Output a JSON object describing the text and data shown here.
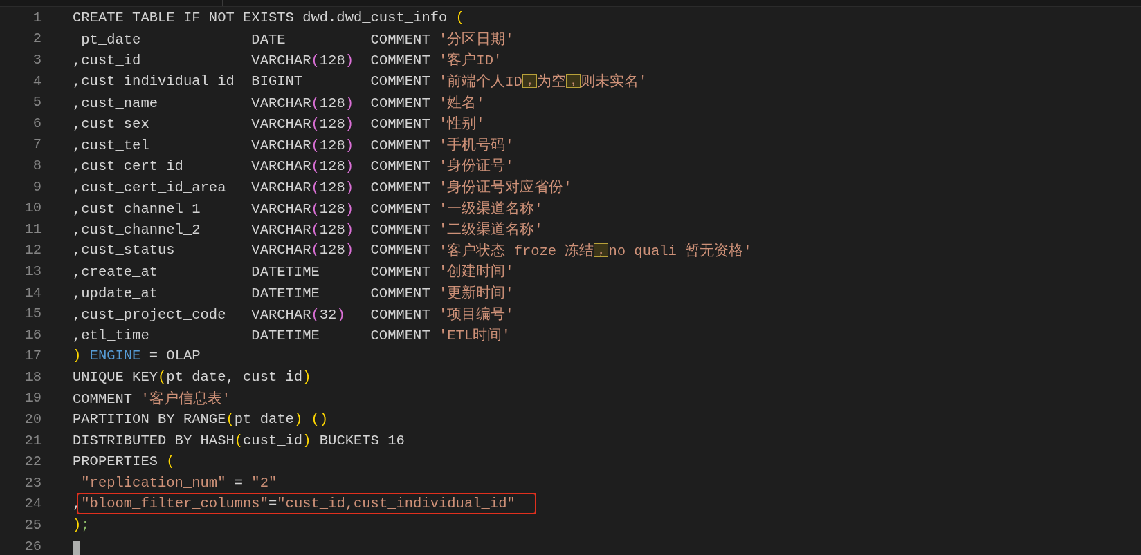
{
  "lines": [
    {
      "number": "1",
      "guide": false,
      "cursor": false,
      "tokens": [
        {
          "kind": "plain",
          "text": "CREATE TABLE IF NOT EXISTS dwd.dwd_cust_info "
        },
        {
          "kind": "bracket",
          "text": "("
        }
      ]
    },
    {
      "number": "2",
      "guide": true,
      "cursor": false,
      "tokens": [
        {
          "kind": "plain",
          "text": "pt_date             DATE          COMMENT "
        },
        {
          "kind": "string",
          "text": "'分区日期'"
        }
      ]
    },
    {
      "number": "3",
      "guide": false,
      "cursor": false,
      "tokens": [
        {
          "kind": "plain",
          "text": ",cust_id             VARCHAR"
        },
        {
          "kind": "paren",
          "text": "("
        },
        {
          "kind": "plain",
          "text": "128"
        },
        {
          "kind": "paren",
          "text": ")"
        },
        {
          "kind": "plain",
          "text": "  COMMENT "
        },
        {
          "kind": "string",
          "text": "'客户ID'"
        }
      ]
    },
    {
      "number": "4",
      "guide": false,
      "cursor": false,
      "tokens": [
        {
          "kind": "plain",
          "text": ",cust_individual_id  BIGINT        COMMENT "
        },
        {
          "kind": "string",
          "text": "'前端个人ID"
        },
        {
          "kind": "ambiguous",
          "text": "，"
        },
        {
          "kind": "string",
          "text": "为空"
        },
        {
          "kind": "ambiguous",
          "text": "，"
        },
        {
          "kind": "string",
          "text": "则未实名'"
        }
      ]
    },
    {
      "number": "5",
      "guide": false,
      "cursor": false,
      "tokens": [
        {
          "kind": "plain",
          "text": ",cust_name           VARCHAR"
        },
        {
          "kind": "paren",
          "text": "("
        },
        {
          "kind": "plain",
          "text": "128"
        },
        {
          "kind": "paren",
          "text": ")"
        },
        {
          "kind": "plain",
          "text": "  COMMENT "
        },
        {
          "kind": "string",
          "text": "'姓名'"
        }
      ]
    },
    {
      "number": "6",
      "guide": false,
      "cursor": false,
      "tokens": [
        {
          "kind": "plain",
          "text": ",cust_sex            VARCHAR"
        },
        {
          "kind": "paren",
          "text": "("
        },
        {
          "kind": "plain",
          "text": "128"
        },
        {
          "kind": "paren",
          "text": ")"
        },
        {
          "kind": "plain",
          "text": "  COMMENT "
        },
        {
          "kind": "string",
          "text": "'性别'"
        }
      ]
    },
    {
      "number": "7",
      "guide": false,
      "cursor": false,
      "tokens": [
        {
          "kind": "plain",
          "text": ",cust_tel            VARCHAR"
        },
        {
          "kind": "paren",
          "text": "("
        },
        {
          "kind": "plain",
          "text": "128"
        },
        {
          "kind": "paren",
          "text": ")"
        },
        {
          "kind": "plain",
          "text": "  COMMENT "
        },
        {
          "kind": "string",
          "text": "'手机号码'"
        }
      ]
    },
    {
      "number": "8",
      "guide": false,
      "cursor": false,
      "tokens": [
        {
          "kind": "plain",
          "text": ",cust_cert_id        VARCHAR"
        },
        {
          "kind": "paren",
          "text": "("
        },
        {
          "kind": "plain",
          "text": "128"
        },
        {
          "kind": "paren",
          "text": ")"
        },
        {
          "kind": "plain",
          "text": "  COMMENT "
        },
        {
          "kind": "string",
          "text": "'身份证号'"
        }
      ]
    },
    {
      "number": "9",
      "guide": false,
      "cursor": false,
      "tokens": [
        {
          "kind": "plain",
          "text": ",cust_cert_id_area   VARCHAR"
        },
        {
          "kind": "paren",
          "text": "("
        },
        {
          "kind": "plain",
          "text": "128"
        },
        {
          "kind": "paren",
          "text": ")"
        },
        {
          "kind": "plain",
          "text": "  COMMENT "
        },
        {
          "kind": "string",
          "text": "'身份证号对应省份'"
        }
      ]
    },
    {
      "number": "10",
      "guide": false,
      "cursor": false,
      "tokens": [
        {
          "kind": "plain",
          "text": ",cust_channel_1      VARCHAR"
        },
        {
          "kind": "paren",
          "text": "("
        },
        {
          "kind": "plain",
          "text": "128"
        },
        {
          "kind": "paren",
          "text": ")"
        },
        {
          "kind": "plain",
          "text": "  COMMENT "
        },
        {
          "kind": "string",
          "text": "'一级渠道名称'"
        }
      ]
    },
    {
      "number": "11",
      "guide": false,
      "cursor": false,
      "tokens": [
        {
          "kind": "plain",
          "text": ",cust_channel_2      VARCHAR"
        },
        {
          "kind": "paren",
          "text": "("
        },
        {
          "kind": "plain",
          "text": "128"
        },
        {
          "kind": "paren",
          "text": ")"
        },
        {
          "kind": "plain",
          "text": "  COMMENT "
        },
        {
          "kind": "string",
          "text": "'二级渠道名称'"
        }
      ]
    },
    {
      "number": "12",
      "guide": false,
      "cursor": false,
      "tokens": [
        {
          "kind": "plain",
          "text": ",cust_status         VARCHAR"
        },
        {
          "kind": "paren",
          "text": "("
        },
        {
          "kind": "plain",
          "text": "128"
        },
        {
          "kind": "paren",
          "text": ")"
        },
        {
          "kind": "plain",
          "text": "  COMMENT "
        },
        {
          "kind": "string",
          "text": "'客户状态 froze 冻结"
        },
        {
          "kind": "ambiguous",
          "text": "，"
        },
        {
          "kind": "string",
          "text": "no_quali 暂无资格'"
        }
      ]
    },
    {
      "number": "13",
      "guide": false,
      "cursor": false,
      "tokens": [
        {
          "kind": "plain",
          "text": ",create_at           DATETIME      COMMENT "
        },
        {
          "kind": "string",
          "text": "'创建时间'"
        }
      ]
    },
    {
      "number": "14",
      "guide": false,
      "cursor": false,
      "tokens": [
        {
          "kind": "plain",
          "text": ",update_at           DATETIME      COMMENT "
        },
        {
          "kind": "string",
          "text": "'更新时间'"
        }
      ]
    },
    {
      "number": "15",
      "guide": false,
      "cursor": false,
      "tokens": [
        {
          "kind": "plain",
          "text": ",cust_project_code   VARCHAR"
        },
        {
          "kind": "paren",
          "text": "("
        },
        {
          "kind": "plain",
          "text": "32"
        },
        {
          "kind": "paren",
          "text": ")"
        },
        {
          "kind": "plain",
          "text": "   COMMENT "
        },
        {
          "kind": "string",
          "text": "'项目编号'"
        }
      ]
    },
    {
      "number": "16",
      "guide": false,
      "cursor": false,
      "tokens": [
        {
          "kind": "plain",
          "text": ",etl_time            DATETIME      COMMENT "
        },
        {
          "kind": "string",
          "text": "'ETL时间'"
        }
      ]
    },
    {
      "number": "17",
      "guide": false,
      "cursor": false,
      "tokens": [
        {
          "kind": "bracket",
          "text": ")"
        },
        {
          "kind": "keyword",
          "text": " ENGINE"
        },
        {
          "kind": "plain",
          "text": " = OLAP"
        }
      ]
    },
    {
      "number": "18",
      "guide": false,
      "cursor": false,
      "tokens": [
        {
          "kind": "plain",
          "text": "UNIQUE KEY"
        },
        {
          "kind": "bracket",
          "text": "("
        },
        {
          "kind": "plain",
          "text": "pt_date, cust_id"
        },
        {
          "kind": "bracket",
          "text": ")"
        }
      ]
    },
    {
      "number": "19",
      "guide": false,
      "cursor": false,
      "tokens": [
        {
          "kind": "plain",
          "text": "COMMENT "
        },
        {
          "kind": "string",
          "text": "'客户信息表'"
        }
      ]
    },
    {
      "number": "20",
      "guide": false,
      "cursor": false,
      "tokens": [
        {
          "kind": "plain",
          "text": "PARTITION BY RANGE"
        },
        {
          "kind": "bracket",
          "text": "("
        },
        {
          "kind": "plain",
          "text": "pt_date"
        },
        {
          "kind": "bracket",
          "text": ")"
        },
        {
          "kind": "bracket",
          "text": " ()"
        }
      ]
    },
    {
      "number": "21",
      "guide": false,
      "cursor": false,
      "tokens": [
        {
          "kind": "plain",
          "text": "DISTRIBUTED BY HASH"
        },
        {
          "kind": "bracket",
          "text": "("
        },
        {
          "kind": "plain",
          "text": "cust_id"
        },
        {
          "kind": "bracket",
          "text": ")"
        },
        {
          "kind": "plain",
          "text": " BUCKETS 16"
        }
      ]
    },
    {
      "number": "22",
      "guide": false,
      "cursor": false,
      "tokens": [
        {
          "kind": "plain",
          "text": "PROPERTIES "
        },
        {
          "kind": "bracket",
          "text": "("
        }
      ]
    },
    {
      "number": "23",
      "guide": true,
      "cursor": false,
      "tokens": [
        {
          "kind": "string",
          "text": "\"replication_num\""
        },
        {
          "kind": "plain",
          "text": " = "
        },
        {
          "kind": "string",
          "text": "\"2\""
        }
      ]
    },
    {
      "number": "24",
      "guide": false,
      "cursor": false,
      "tokens": [
        {
          "kind": "plain",
          "text": ","
        },
        {
          "kind": "annotation",
          "tokens": [
            {
              "kind": "string",
              "text": "\"bloom_filter_columns\""
            },
            {
              "kind": "plain",
              "text": "="
            },
            {
              "kind": "string",
              "text": "\"cust_id,cust_individual_id\""
            }
          ]
        }
      ]
    },
    {
      "number": "25",
      "guide": false,
      "cursor": false,
      "tokens": [
        {
          "kind": "bracket",
          "text": ")"
        },
        {
          "kind": "punct",
          "text": ";"
        }
      ]
    },
    {
      "number": "26",
      "guide": false,
      "cursor": true
    }
  ]
}
